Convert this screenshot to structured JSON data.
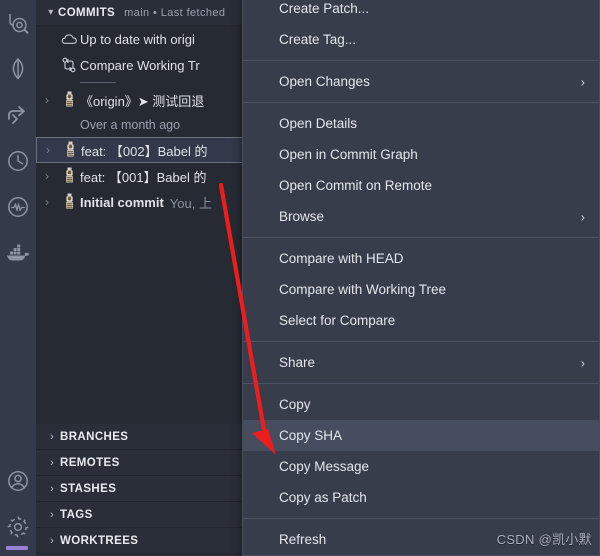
{
  "colors": {
    "activitybar_bg": "#343a4a",
    "sidepanel_bg": "#2a2e39",
    "commits_bg": "#262a33",
    "menu_bg": "#383d4b",
    "menu_highlight": "#464d5f",
    "accent_purple": "#9b7fd4",
    "arrow_red": "#ee1c1c",
    "text_primary": "#e3e6ec",
    "text_muted": "#9aa0ae"
  },
  "activitybar": {
    "top_icons": [
      {
        "name": "search-database-icon",
        "label": "Search"
      },
      {
        "name": "leaf-mongodb-icon",
        "label": "MongoDB"
      },
      {
        "name": "share-arrow-icon",
        "label": "Share"
      },
      {
        "name": "history-clock-icon",
        "label": "Timeline"
      },
      {
        "name": "activity-monitor-icon",
        "label": "Monitor"
      },
      {
        "name": "docker-whale-icon",
        "label": "Docker"
      }
    ],
    "bottom_icons": [
      {
        "name": "account-icon",
        "label": "Accounts"
      },
      {
        "name": "settings-gear-icon",
        "label": "Manage"
      }
    ]
  },
  "sidebar": {
    "commits": {
      "title": "COMMITS",
      "description": "main • Last fetched",
      "chevron": "chevron-down-icon",
      "rows": [
        {
          "type": "status",
          "icon": "cloud-icon",
          "label": "Up to date with origi",
          "meta": ""
        },
        {
          "type": "status",
          "icon": "compare-branch-icon",
          "label": "Compare Working Tr",
          "meta": ""
        },
        {
          "type": "separator"
        },
        {
          "type": "commit",
          "icon": "commit-avatar-icon",
          "chevron": "chevron-right-icon",
          "label": "《origin》➤ 测试回退",
          "meta": "",
          "selected": false
        },
        {
          "type": "group",
          "label": "Over a month ago"
        },
        {
          "type": "commit",
          "icon": "commit-avatar-icon",
          "chevron": "chevron-right-icon",
          "label": "feat: 【002】Babel 的",
          "meta": "",
          "selected": true
        },
        {
          "type": "commit",
          "icon": "commit-avatar-icon",
          "chevron": "chevron-right-icon",
          "label": "feat: 【001】Babel 的",
          "meta": "",
          "selected": false
        },
        {
          "type": "commit",
          "icon": "commit-avatar-icon",
          "chevron": "chevron-right-icon",
          "label": "Initial commit",
          "meta": "You, 上",
          "selected": false
        }
      ]
    },
    "lower_sections": [
      {
        "label": "BRANCHES",
        "chevron": "chevron-right-icon"
      },
      {
        "label": "REMOTES",
        "chevron": "chevron-right-icon"
      },
      {
        "label": "STASHES",
        "chevron": "chevron-right-icon"
      },
      {
        "label": "TAGS",
        "chevron": "chevron-right-icon"
      },
      {
        "label": "WORKTREES",
        "chevron": "chevron-right-icon"
      }
    ]
  },
  "context_menu": {
    "items": [
      {
        "label": "Create Patch...",
        "submenu": false,
        "highlight": false
      },
      {
        "label": "Create Tag...",
        "submenu": false,
        "highlight": false
      },
      {
        "type": "separator"
      },
      {
        "label": "Open Changes",
        "submenu": true,
        "highlight": false
      },
      {
        "type": "separator"
      },
      {
        "label": "Open Details",
        "submenu": false,
        "highlight": false
      },
      {
        "label": "Open in Commit Graph",
        "submenu": false,
        "highlight": false
      },
      {
        "label": "Open Commit on Remote",
        "submenu": false,
        "highlight": false
      },
      {
        "label": "Browse",
        "submenu": true,
        "highlight": false
      },
      {
        "type": "separator"
      },
      {
        "label": "Compare with HEAD",
        "submenu": false,
        "highlight": false
      },
      {
        "label": "Compare with Working Tree",
        "submenu": false,
        "highlight": false
      },
      {
        "label": "Select for Compare",
        "submenu": false,
        "highlight": false
      },
      {
        "type": "separator"
      },
      {
        "label": "Share",
        "submenu": true,
        "highlight": false
      },
      {
        "type": "separator"
      },
      {
        "label": "Copy",
        "submenu": false,
        "highlight": false
      },
      {
        "label": "Copy SHA",
        "submenu": false,
        "highlight": true
      },
      {
        "label": "Copy Message",
        "submenu": false,
        "highlight": false
      },
      {
        "label": "Copy as Patch",
        "submenu": false,
        "highlight": false
      },
      {
        "type": "separator"
      },
      {
        "label": "Refresh",
        "submenu": false,
        "highlight": false
      }
    ],
    "submenu_chevron": "chevron-right-icon"
  },
  "annotation": {
    "arrow_name": "red-pointer-arrow",
    "points_to": "Copy SHA"
  },
  "watermark": {
    "text": "CSDN @凯小默"
  }
}
